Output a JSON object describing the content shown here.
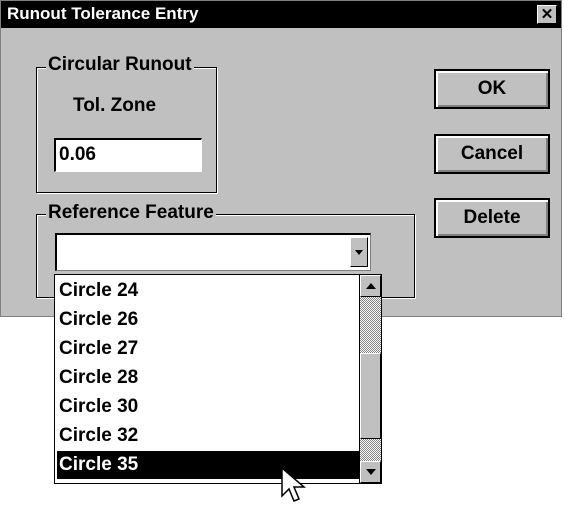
{
  "dialog": {
    "title": "Runout Tolerance Entry",
    "close_glyph": "✕"
  },
  "circular_runout": {
    "group_label": "Circular Runout",
    "tol_zone_label": "Tol. Zone",
    "tol_zone_value": "0.06"
  },
  "reference_feature": {
    "group_label": "Reference Feature",
    "selected_value": ""
  },
  "buttons": {
    "ok": "OK",
    "cancel": "Cancel",
    "delete": "Delete"
  },
  "dropdown": {
    "items": [
      "Circle 24",
      "Circle 26",
      "Circle 27",
      "Circle 28",
      "Circle 30",
      "Circle 32",
      "Circle 35"
    ],
    "highlighted_index": 6
  },
  "colors": {
    "face": "#c0c0c0",
    "title_bar": "#000000",
    "highlight": "#000000"
  }
}
